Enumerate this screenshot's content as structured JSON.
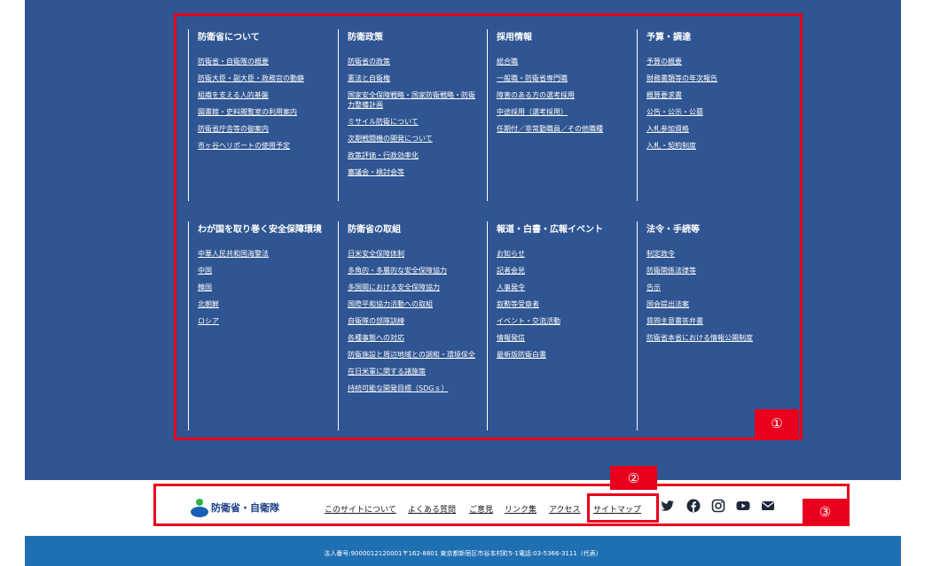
{
  "columns_row1": [
    {
      "title": "防衛省について",
      "links": [
        "防衛省・自衛隊の概要",
        "防衛大臣・副大臣・政務官の動静",
        "組織を支える人的基盤",
        "図書館・史料閲覧室の利用案内",
        "防衛省庁舎等の御案内",
        "市ヶ谷ヘリポートの使用予定"
      ]
    },
    {
      "title": "防衛政策",
      "links": [
        "防衛省の政策",
        "憲法と自衛権",
        "国家安全保障戦略・国家防衛戦略・防衛力整備計画",
        "ミサイル防衛について",
        "次期戦闘機の開発について",
        "政策評価・行政効率化",
        "審議会・検討会等"
      ]
    },
    {
      "title": "採用情報",
      "links": [
        "総合職",
        "一般職・防衛省専門職",
        "障害のある方の選考採用",
        "中途採用（選考採用）",
        "任期付／非常勤職員／その他職種"
      ]
    },
    {
      "title": "予算・調達",
      "links": [
        "予算の概要",
        "財務書類等の年次報告",
        "概算要求書",
        "公告・公示・公募",
        "入札参加資格",
        "入札・契約制度"
      ]
    }
  ],
  "columns_row2": [
    {
      "title": "わが国を取り巻く安全保障環境",
      "links": [
        "中華人民共和国海警法",
        "中国",
        "韓国",
        "北朝鮮",
        "ロシア"
      ]
    },
    {
      "title": "防衛省の取組",
      "links": [
        "日米安全保障体制",
        "多角的・多層的な安全保障協力",
        "多国間における安全保障協力",
        "国際平和協力活動への取組",
        "自衛隊の部隊訓練",
        "各種事態への対応",
        "防衛施設と周辺地域との調和・環境保全",
        "在日米軍に関する諸施策",
        "持続可能な開発目標（SDGｓ）"
      ]
    },
    {
      "title": "報道・白書・広報イベント",
      "links": [
        "お知らせ",
        "記者会見",
        "人事発令",
        "叙勲等受章者",
        "イベント・交流活動",
        "情報発信",
        "最新版防衛白書"
      ]
    },
    {
      "title": "法令・手続等",
      "links": [
        "制定政令",
        "防衛関係法律等",
        "告示",
        "国会提出法案",
        "質問主意書答弁書",
        "防衛省本省における情報公開制度"
      ]
    }
  ],
  "badges": {
    "one": "①",
    "two": "②",
    "three": "③"
  },
  "logo": {
    "text": "防衛省・自衛隊"
  },
  "footer_links": [
    "このサイトについて",
    "よくある質問",
    "ご意見",
    "リンク集",
    "アクセス",
    "サイトマップ"
  ],
  "social": [
    "twitter-icon",
    "facebook-icon",
    "instagram-icon",
    "youtube-icon",
    "mail-icon"
  ],
  "address": "法人番号:9000012120001〒162-8801 東京都新宿区市谷本村町5-1電話:03-5366-3111（代表）",
  "colors": {
    "nav_bg": "#2f5592",
    "highlight": "#e8001c",
    "bottom_bar": "#1f6fb3",
    "logo_text": "#1a3d85"
  }
}
